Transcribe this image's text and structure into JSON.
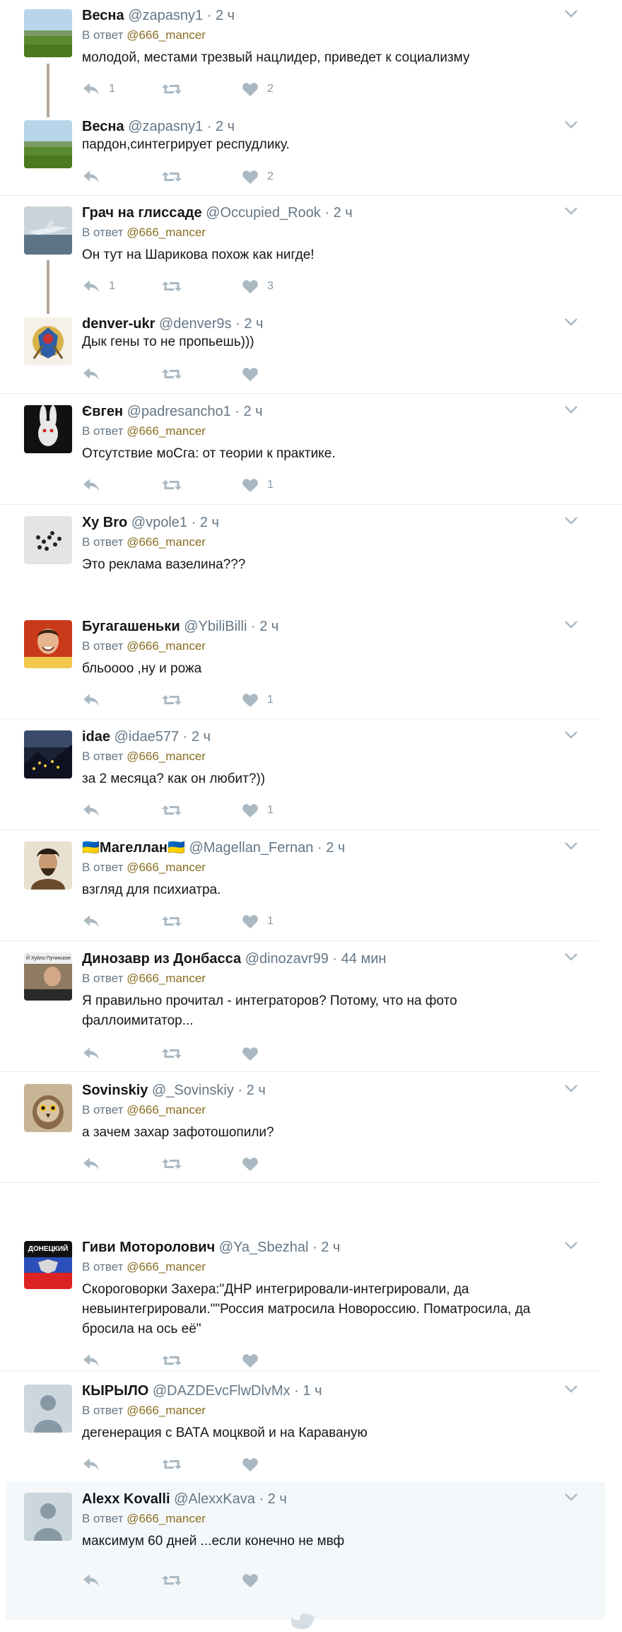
{
  "tweets": [
    {
      "name": "Весна",
      "handle": "@zapasny1",
      "time": "2 ч",
      "reply_label": "В ответ",
      "reply_to": "@666_mancer",
      "text": "молодой, местами трезвый нацлидер, приведет к социализму",
      "replies": "1",
      "retweets": "",
      "likes": "2",
      "avatar": "field-photo"
    },
    {
      "name": "Весна",
      "handle": "@zapasny1",
      "time": "2 ч",
      "text": "пардон,синтегрирует респудлику.",
      "replies": "",
      "retweets": "",
      "likes": "2",
      "avatar": "field-photo"
    },
    {
      "name": "Грач на глиссаде",
      "handle": "@Occupied_Rook",
      "time": "2 ч",
      "reply_label": "В ответ",
      "reply_to": "@666_mancer",
      "text": "Он тут на Шарикова похож как нигде!",
      "replies": "1",
      "retweets": "",
      "likes": "3",
      "avatar": "plane-photo"
    },
    {
      "name": "denver-ukr",
      "handle": "@denver9s",
      "time": "2 ч",
      "text": "Дык гены то не пропьешь)))",
      "replies": "",
      "retweets": "",
      "likes": "",
      "avatar": "emblem-photo"
    },
    {
      "name": "Євген",
      "handle": "@padresancho1",
      "time": "2 ч",
      "reply_label": "В ответ",
      "reply_to": "@666_mancer",
      "text": "Отсутствие моСга: от теории к практике.",
      "replies": "",
      "retweets": "",
      "likes": "1",
      "avatar": "rabbit-photo"
    },
    {
      "name": "Ху Bro",
      "handle": "@vpole1",
      "time": "2 ч",
      "reply_label": "В ответ",
      "reply_to": "@666_mancer",
      "text": "Это реклама вазелина???",
      "replies": "",
      "retweets": "",
      "likes": "",
      "avatar": "seeds-photo"
    },
    {
      "name": "Бугагашеньки",
      "handle": "@YbiliBilli",
      "time": "2 ч",
      "reply_label": "В ответ",
      "reply_to": "@666_mancer",
      "text": "бльоооо ,ну и рожа",
      "replies": "",
      "retweets": "",
      "likes": "1",
      "avatar": "face-photo"
    },
    {
      "name": "idae",
      "handle": "@idae577",
      "time": "2 ч",
      "reply_label": "В ответ",
      "reply_to": "@666_mancer",
      "text": "за 2 месяца? как он любит?))",
      "replies": "",
      "retweets": "",
      "likes": "1",
      "avatar": "city-photo"
    },
    {
      "name": "🇺🇦Магеллан🇺🇦",
      "handle": "@Magellan_Fernan",
      "time": "2 ч",
      "reply_label": "В ответ",
      "reply_to": "@666_mancer",
      "text": "взгляд для психиатра.",
      "replies": "",
      "retweets": "",
      "likes": "1",
      "avatar": "portrait-photo"
    },
    {
      "name": "Динозавр из Донбасса",
      "handle": "@dinozavr99",
      "time": "44 мин",
      "reply_label": "В ответ",
      "reply_to": "@666_mancer",
      "text1": "Я правильно прочитал - интеграторов? Потому, что на фото",
      "text2": "фаллоимитатор...",
      "replies": "",
      "retweets": "",
      "likes": "",
      "avatar": "tv-photo",
      "avatar_caption": "Й Хуйло Путинское"
    },
    {
      "name": "Sovinskiy",
      "handle": "@_Sovinskiy",
      "time": "2 ч",
      "reply_label": "В ответ",
      "reply_to": "@666_mancer",
      "text": "а зачем захар зафотошопили?",
      "replies": "",
      "retweets": "",
      "likes": "",
      "avatar": "owl-photo"
    },
    {
      "name": "Гиви Моторолович",
      "handle": "@Ya_Sbezhal",
      "time": "2 ч",
      "reply_label": "В ответ",
      "reply_to": "@666_mancer",
      "text1": "Скороговорки Захера:\"ДНР интегрировали-интегрировали, да",
      "text2": "невыинтегрировали.\"\"Россия матросила Новороссию. Поматросила, да",
      "text3": "бросила на ось её\"",
      "replies": "",
      "retweets": "",
      "likes": "",
      "avatar": "flag-logo",
      "avatar_caption": "ДОНЕЦКИЙ"
    },
    {
      "name": "КЫРЫЛО",
      "handle": "@DAZDEvcFlwDlvMx",
      "time": "1 ч",
      "reply_label": "В ответ",
      "reply_to": "@666_mancer",
      "text": "дегенерация с ВАТА моцквой и на Караваную",
      "replies": "",
      "retweets": "",
      "likes": "",
      "avatar": "default-avatar"
    },
    {
      "name": "Alexx Kovalli",
      "handle": "@AlexxKava",
      "time": "2 ч",
      "reply_label": "В ответ",
      "reply_to": "@666_mancer",
      "text": "максимум 60 дней ...если конечно не мвф",
      "replies": "",
      "retweets": "",
      "likes": "",
      "avatar": "default-avatar"
    }
  ],
  "icons": {
    "reply": "reply-icon",
    "retweet": "retweet-icon",
    "like": "heart-icon",
    "menu": "chevron-down-icon",
    "footer": "bird-icon"
  },
  "colors": {
    "action_gray": "#aab8c2",
    "handle_gray": "#657786",
    "mention": "#8a6d1f",
    "thread_line": "#b5a79a",
    "separator": "#e6ecf0"
  }
}
